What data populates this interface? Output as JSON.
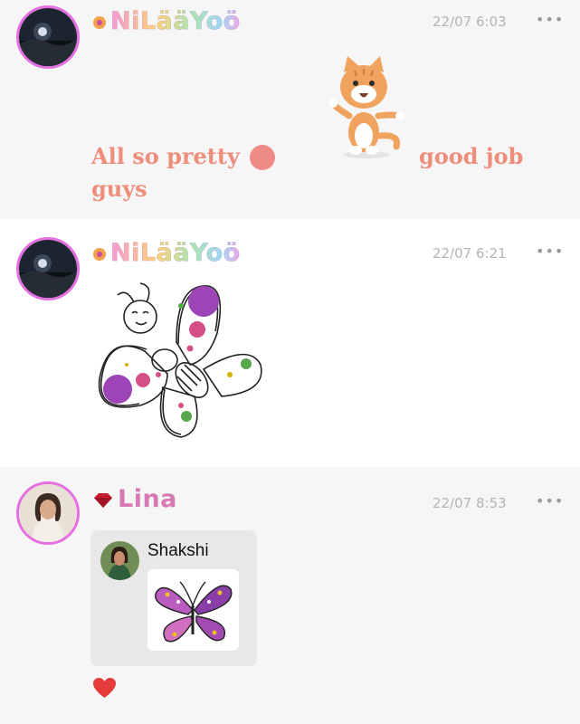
{
  "posts": [
    {
      "username": "NiLääYoö",
      "timestamp": "22/07 6:03",
      "more": "•••",
      "message": {
        "line1": "All so pretty",
        "line2": "guys",
        "line3": "good job"
      },
      "sticker": "cat-waving",
      "emoji": "red-circle"
    },
    {
      "username": "NiLääYoö",
      "timestamp": "22/07 6:21",
      "more": "•••",
      "image": "butterfly-drawing"
    },
    {
      "username": "Lina",
      "timestamp": "22/07 8:53",
      "more": "•••",
      "quoted": {
        "name": "Shakshi",
        "image": "butterfly-drawing"
      },
      "reaction": "heart"
    }
  ],
  "colors": {
    "avatar_border": "#e56fe0",
    "message_text": "#ee8e7a",
    "timestamp": "#b4b4b4",
    "lina_name": "#d77ab4"
  }
}
